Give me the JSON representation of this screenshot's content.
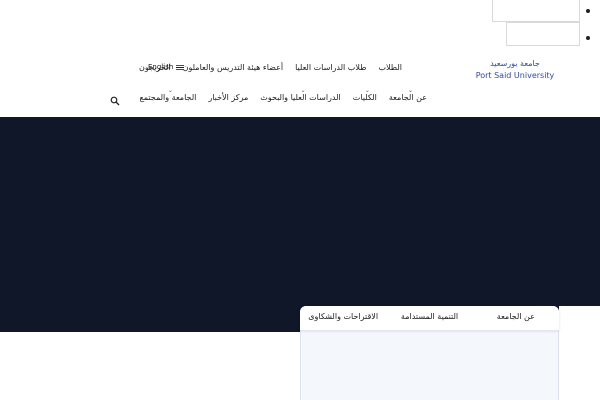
{
  "logo": {
    "arabic": "جامعة بورسعيد",
    "english": "Port Said University"
  },
  "nav": {
    "row1": [
      "الطلاب",
      "طلاب الدراسات العليا",
      "أعضاء هيئة التدريس والعاملون",
      "الخريجون"
    ],
    "row2": [
      "عن الجامعة",
      "الكليات",
      "الدراسات العليا والبحوث",
      "مركز الأخبار",
      "الجامعة والمجتمع"
    ],
    "language": "English"
  },
  "tabs": [
    "عن الجامعة",
    "التنمية المستدامة",
    "الاقتراحات والشكاوى"
  ],
  "colors": {
    "hero": "#0f1729",
    "logo": "#2e4aa6",
    "card": "#f4f8fd"
  },
  "icons": {
    "search": "search-icon",
    "flag": "uk-flag-icon",
    "chevron": "chevron-down-icon"
  }
}
